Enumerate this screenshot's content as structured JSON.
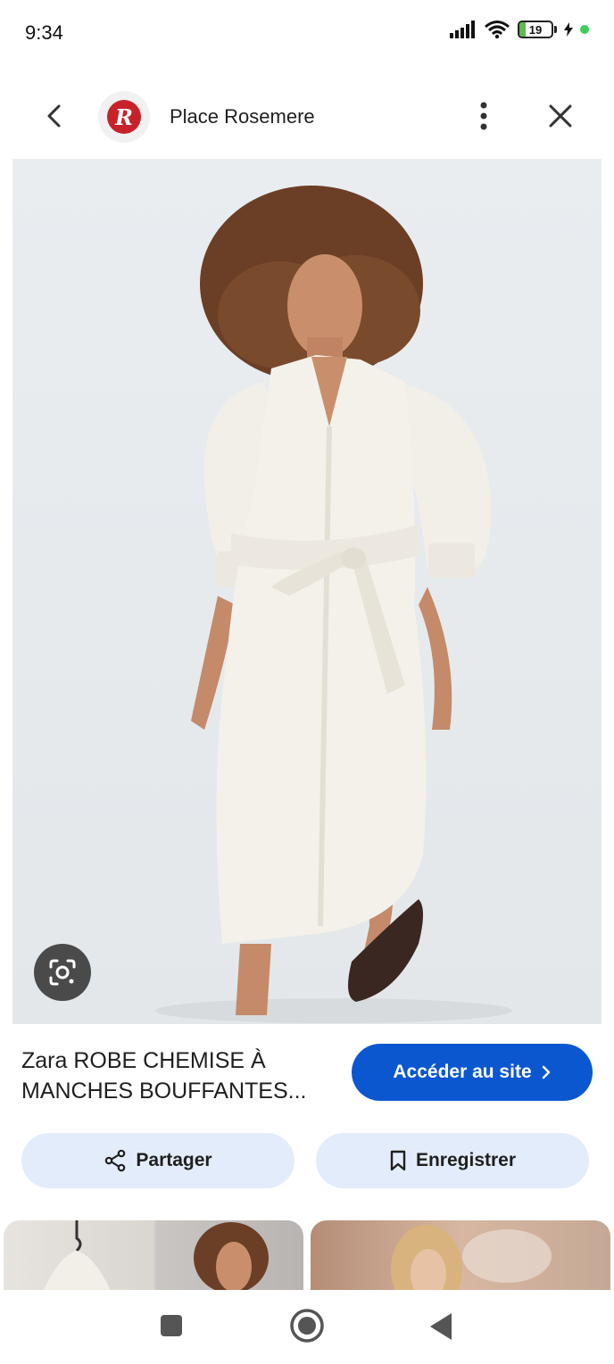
{
  "status_bar": {
    "time": "9:34",
    "battery_level": "19",
    "battery_fill_fraction": 0.19,
    "icons": [
      "signal-icon",
      "wifi-icon",
      "battery-icon",
      "charging-icon"
    ]
  },
  "header": {
    "site_name": "Place Rosemere",
    "logo_letter": "R",
    "icons": [
      "back-arrow-icon",
      "more-vert-icon",
      "close-icon"
    ]
  },
  "product": {
    "title": "Zara ROBE CHEMISE À MANCHES BOUFFANTES...",
    "visit_label": "Accéder au site"
  },
  "actions": {
    "share_label": "Partager",
    "save_label": "Enregistrer"
  },
  "colors": {
    "accent": "#0b57d0",
    "action_bg": "#e3ecfb",
    "brand_logo": "#c7222a"
  }
}
